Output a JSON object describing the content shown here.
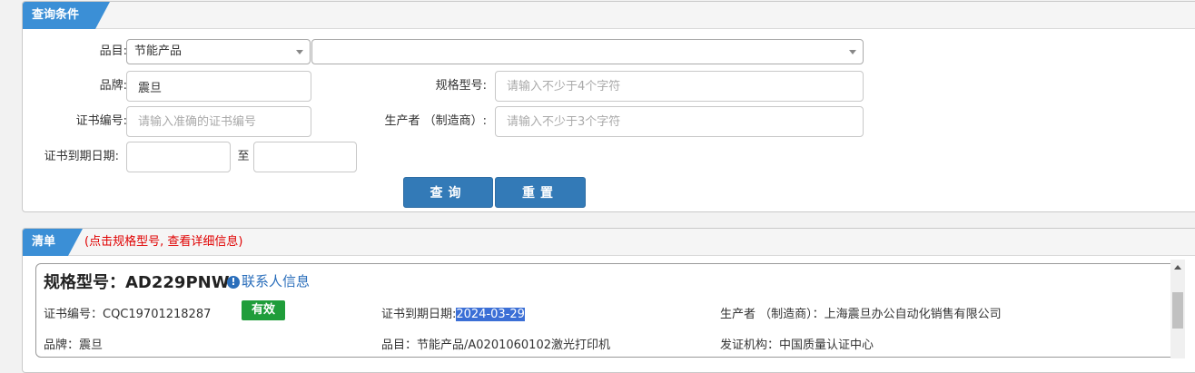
{
  "query": {
    "header": "查询条件",
    "category": {
      "label": "品目:",
      "value": "节能产品",
      "sub_value": ""
    },
    "brand": {
      "label": "品牌:",
      "value": "震旦"
    },
    "model": {
      "label": "规格型号:",
      "placeholder": "请输入不少于4个字符"
    },
    "cert_no": {
      "label": "证书编号:",
      "placeholder": "请输入准确的证书编号"
    },
    "producer": {
      "label": "生产者 （制造商）:",
      "placeholder": "请输入不少于3个字符"
    },
    "expiry": {
      "label": "证书到期日期:",
      "to_label": "至",
      "from_value": "",
      "to_value": ""
    },
    "search_button": "查询",
    "reset_button": "重置"
  },
  "list": {
    "header": "清单",
    "hint": "(点击规格型号, 查看详细信息)",
    "items": [
      {
        "title": "规格型号：AD229PNW",
        "contact_link": "联系人信息",
        "contact_icon": "info-circle-icon",
        "cert_no": "证书编号：CQC19701218287",
        "status": "有效",
        "status_color": "#1f9d3a",
        "expiry_label": "证书到期日期:",
        "expiry_value": "2024-03-29",
        "producer": "生产者 （制造商）：上海震旦办公自动化销售有限公司",
        "brand": "品牌：震旦",
        "category": "品目：节能产品/A0201060102激光打印机",
        "issuer": "发证机构：中国质量认证中心"
      }
    ]
  },
  "colors": {
    "accent": "#3b8fd6",
    "button": "#337ab7",
    "hint": "#e00000"
  }
}
